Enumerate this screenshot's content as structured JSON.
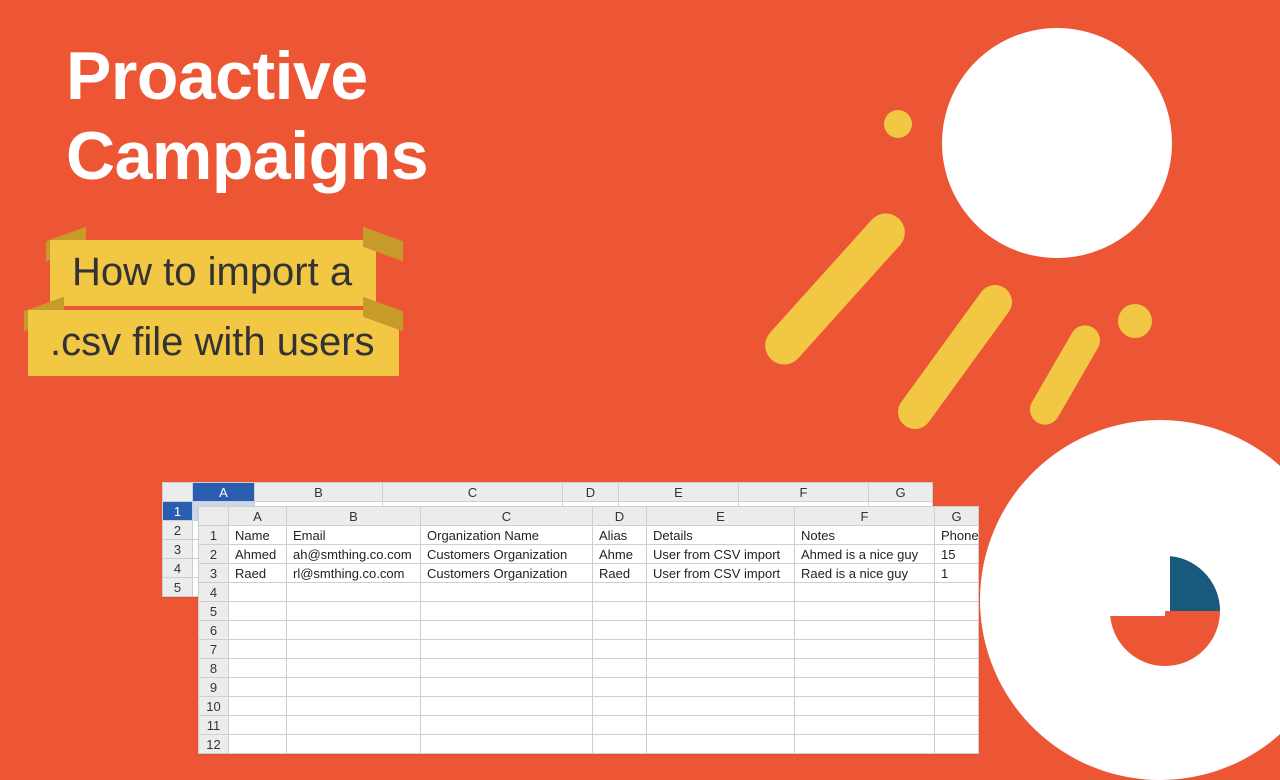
{
  "title_line1": "Proactive",
  "title_line2": "Campaigns",
  "subtitle_line1": "How to import a",
  "subtitle_line2": ".csv file with users",
  "spreadsheet": {
    "columns": [
      "A",
      "B",
      "C",
      "D",
      "E",
      "F",
      "G"
    ],
    "back_header": {
      "A": "Name",
      "B": "Email",
      "C": "Organization Name",
      "D": "Alias",
      "E": "Details",
      "F": "Notes",
      "G": "Phone"
    },
    "front_rows": [
      {
        "n": "1",
        "A": "Name",
        "B": "Email",
        "C": "Organization Name",
        "D": "Alias",
        "E": "Details",
        "F": "Notes",
        "G": "Phone"
      },
      {
        "n": "2",
        "A": "Ahmed",
        "B": "ah@smthing.co.com",
        "C": "Customers Organization",
        "D": "Ahme",
        "E": "User from CSV import",
        "F": "Ahmed is a nice guy",
        "G": "15"
      },
      {
        "n": "3",
        "A": "Raed",
        "B": "rl@smthing.co.com",
        "C": "Customers Organization",
        "D": "Raed",
        "E": "User from CSV import",
        "F": "Raed is a nice guy",
        "G": "1"
      }
    ],
    "empty_rows": [
      "4",
      "5",
      "6",
      "7",
      "8",
      "9",
      "10",
      "11",
      "12"
    ]
  }
}
